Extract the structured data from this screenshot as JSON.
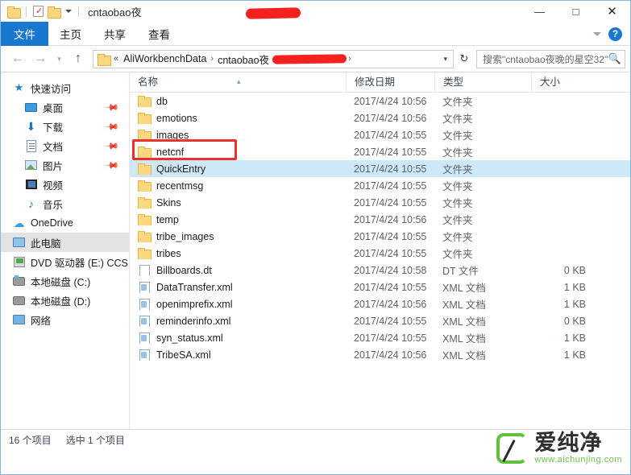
{
  "window": {
    "title": "cntaobao夜",
    "title_redacted": true,
    "quick_access_toolbar": [
      {
        "name": "folder-icon",
        "label": "属性"
      },
      {
        "name": "properties-icon",
        "label": "属性"
      },
      {
        "name": "new-folder-icon",
        "label": "新建文件夹"
      },
      {
        "name": "customize-caret-icon",
        "label": "自定义快速访问工具栏"
      }
    ],
    "controls": {
      "minimize": "—",
      "maximize": "□",
      "close": "✕"
    }
  },
  "ribbon": {
    "tabs": [
      {
        "label": "文件",
        "active": true
      },
      {
        "label": "主页",
        "active": false
      },
      {
        "label": "共享",
        "active": false
      },
      {
        "label": "查看",
        "active": false
      }
    ],
    "collapse_icon": "chevron-down-icon",
    "help_label": "?"
  },
  "addressbar": {
    "back": "←",
    "forward": "→",
    "recent": "▾",
    "up": "↑",
    "chevrons": "«",
    "crumbs": [
      {
        "label": "AliWorkbenchData",
        "redacted": false
      },
      {
        "label": "cntaobao夜",
        "redacted": true
      }
    ],
    "separator": "›",
    "dropdown": "▾",
    "refresh": "↻"
  },
  "search": {
    "placeholder": "搜索\"cntaobao夜晚的星空32\"",
    "icon": "search-icon"
  },
  "sidebar": {
    "items": [
      {
        "label": "快速访问",
        "icon": "star-icon",
        "level": 1,
        "pinned": false,
        "selected": false
      },
      {
        "label": "桌面",
        "icon": "desktop-icon",
        "level": 2,
        "pinned": true,
        "selected": false
      },
      {
        "label": "下载",
        "icon": "download-icon",
        "level": 2,
        "pinned": true,
        "selected": false
      },
      {
        "label": "文档",
        "icon": "document-icon",
        "level": 2,
        "pinned": true,
        "selected": false
      },
      {
        "label": "图片",
        "icon": "pictures-icon",
        "level": 2,
        "pinned": true,
        "selected": false
      },
      {
        "label": "视频",
        "icon": "video-icon",
        "level": 2,
        "pinned": false,
        "selected": false
      },
      {
        "label": "音乐",
        "icon": "music-icon",
        "level": 2,
        "pinned": false,
        "selected": false
      },
      {
        "label": "OneDrive",
        "icon": "cloud-icon",
        "level": 1,
        "pinned": false,
        "selected": false
      },
      {
        "label": "此电脑",
        "icon": "computer-icon",
        "level": 1,
        "pinned": false,
        "selected": true
      },
      {
        "label": "DVD 驱动器 (E:) CCS",
        "icon": "dvd-icon",
        "level": 1,
        "pinned": false,
        "selected": false
      },
      {
        "label": "本地磁盘 (C:)",
        "icon": "disk-c-icon",
        "level": 1,
        "pinned": false,
        "selected": false
      },
      {
        "label": "本地磁盘 (D:)",
        "icon": "disk-icon",
        "level": 1,
        "pinned": false,
        "selected": false
      },
      {
        "label": "网络",
        "icon": "network-icon",
        "level": 1,
        "pinned": false,
        "selected": false
      }
    ]
  },
  "filelist": {
    "columns": [
      "名称",
      "修改日期",
      "类型",
      "大小"
    ],
    "sort_column": "名称",
    "sort_indicator": "▴",
    "rows": [
      {
        "name": "db",
        "date": "2017/4/24 10:56",
        "type": "文件夹",
        "size": "",
        "icon": "folder",
        "selected": false
      },
      {
        "name": "emotions",
        "date": "2017/4/24 10:56",
        "type": "文件夹",
        "size": "",
        "icon": "folder",
        "selected": false
      },
      {
        "name": "images",
        "date": "2017/4/24 10:55",
        "type": "文件夹",
        "size": "",
        "icon": "folder",
        "selected": false
      },
      {
        "name": "netcnf",
        "date": "2017/4/24 10:55",
        "type": "文件夹",
        "size": "",
        "icon": "folder",
        "selected": false
      },
      {
        "name": "QuickEntry",
        "date": "2017/4/24 10:55",
        "type": "文件夹",
        "size": "",
        "icon": "folder",
        "selected": true
      },
      {
        "name": "recentmsg",
        "date": "2017/4/24 10:55",
        "type": "文件夹",
        "size": "",
        "icon": "folder",
        "selected": false
      },
      {
        "name": "Skins",
        "date": "2017/4/24 10:55",
        "type": "文件夹",
        "size": "",
        "icon": "folder",
        "selected": false
      },
      {
        "name": "temp",
        "date": "2017/4/24 10:56",
        "type": "文件夹",
        "size": "",
        "icon": "folder",
        "selected": false
      },
      {
        "name": "tribe_images",
        "date": "2017/4/24 10:55",
        "type": "文件夹",
        "size": "",
        "icon": "folder",
        "selected": false
      },
      {
        "name": "tribes",
        "date": "2017/4/24 10:55",
        "type": "文件夹",
        "size": "",
        "icon": "folder",
        "selected": false
      },
      {
        "name": "Billboards.dt",
        "date": "2017/4/24 10:58",
        "type": "DT 文件",
        "size": "0 KB",
        "icon": "generic",
        "selected": false
      },
      {
        "name": "DataTransfer.xml",
        "date": "2017/4/24 10:55",
        "type": "XML 文档",
        "size": "1 KB",
        "icon": "xml",
        "selected": false
      },
      {
        "name": "openimprefix.xml",
        "date": "2017/4/24 10:56",
        "type": "XML 文档",
        "size": "1 KB",
        "icon": "xml",
        "selected": false
      },
      {
        "name": "reminderinfo.xml",
        "date": "2017/4/24 10:55",
        "type": "XML 文档",
        "size": "0 KB",
        "icon": "xml",
        "selected": false
      },
      {
        "name": "syn_status.xml",
        "date": "2017/4/24 10:55",
        "type": "XML 文档",
        "size": "1 KB",
        "icon": "xml",
        "selected": false
      },
      {
        "name": "TribeSA.xml",
        "date": "2017/4/24 10:56",
        "type": "XML 文档",
        "size": "1 KB",
        "icon": "xml",
        "selected": false
      }
    ],
    "annotation": {
      "target": "QuickEntry",
      "color": "#e8322b"
    }
  },
  "statusbar": {
    "item_count": "16 个项目",
    "selection": "选中 1 个项目"
  },
  "watermark": {
    "brand": "爱纯净",
    "url": "www.aichunjing.com",
    "accent": "#5fc13c"
  }
}
